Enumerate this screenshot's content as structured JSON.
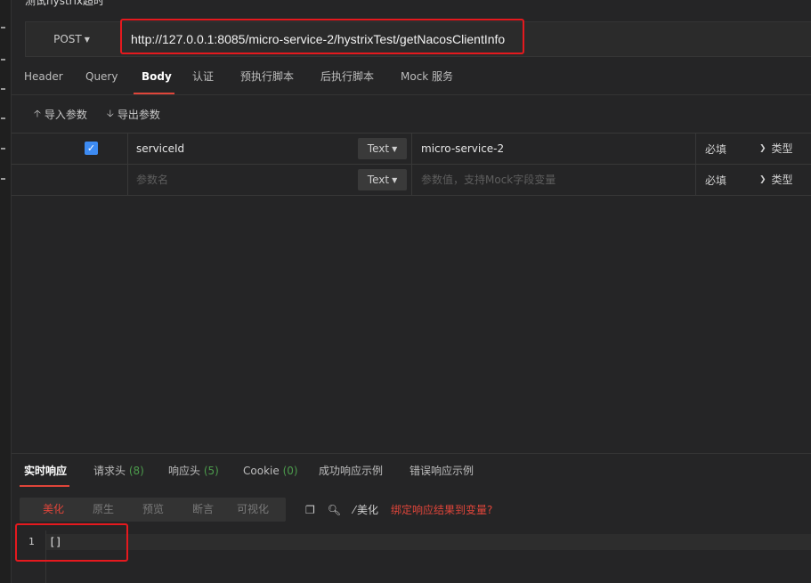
{
  "page": {
    "title": "测试hystrix超时"
  },
  "request": {
    "method": "POST",
    "url": "http://127.0.0.1:8085/micro-service-2/hystrixTest/getNacosClientInfo"
  },
  "tabs": [
    {
      "label": "Header"
    },
    {
      "label": "Query"
    },
    {
      "label": "Body"
    },
    {
      "label": "认证"
    },
    {
      "label": "预执行脚本"
    },
    {
      "label": "后执行脚本"
    },
    {
      "label": "Mock 服务"
    }
  ],
  "params_toolbar": {
    "import_label": "导入参数",
    "export_label": "导出参数"
  },
  "params": {
    "rows": [
      {
        "checked": true,
        "name": "serviceId",
        "type": "Text",
        "value": "micro-service-2",
        "required": "必填",
        "type_col": "类型"
      }
    ],
    "empty_row": {
      "name_placeholder": "参数名",
      "type": "Text",
      "value_placeholder": "参数值，支持Mock字段变量",
      "required": "必填",
      "type_col": "类型"
    }
  },
  "response_tabs": [
    {
      "label": "实时响应",
      "count": ""
    },
    {
      "label": "请求头",
      "count": "(8)"
    },
    {
      "label": "响应头",
      "count": "(5)"
    },
    {
      "label": "Cookie",
      "count": "(0)"
    },
    {
      "label": "成功响应示例",
      "count": ""
    },
    {
      "label": "错误响应示例",
      "count": ""
    }
  ],
  "view_modes": [
    {
      "label": "美化"
    },
    {
      "label": "原生"
    },
    {
      "label": "预览"
    },
    {
      "label": "断言"
    },
    {
      "label": "可视化"
    }
  ],
  "response_tools": {
    "beautify_label": "美化",
    "bind_label": "绑定响应结果到变量?"
  },
  "response_body": {
    "line_number": "1",
    "text": "[]"
  },
  "icons": {
    "copy": "copy-icon",
    "search": "search-icon",
    "magic": "magic-wand-icon"
  },
  "colors": {
    "accent": "#e0453a",
    "highlight": "#e5191e",
    "checkbox": "#3d8bf2"
  }
}
